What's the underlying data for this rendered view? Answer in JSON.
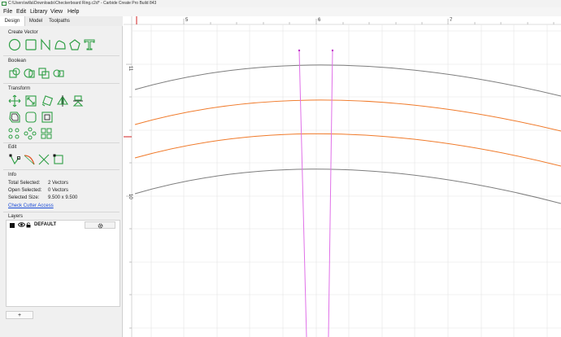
{
  "window": {
    "title": "C:\\Users\\willa\\Downloads\\Checkerboard Ring.c2d* - Carbide Create Pro Build 843"
  },
  "menu": {
    "items": [
      {
        "label": "File",
        "icon": "file-menu"
      },
      {
        "label": "Edit",
        "icon": "edit-menu"
      },
      {
        "label": "Library",
        "icon": "library-menu"
      },
      {
        "label": "View",
        "icon": "view-menu"
      },
      {
        "label": "Help",
        "icon": "help-menu"
      }
    ]
  },
  "tabs": [
    {
      "label": "Design",
      "active": true
    },
    {
      "label": "Model",
      "active": false
    },
    {
      "label": "Toolpaths",
      "active": false
    }
  ],
  "sections": {
    "create_vector": "Create Vector",
    "boolean": "Boolean",
    "transform": "Transform",
    "edit": "Edit",
    "info": "Info",
    "layers": "Layers"
  },
  "tool_icons": {
    "create_vector": [
      "circle-icon",
      "rectangle-icon",
      "polyline-icon",
      "curve-icon",
      "polygon-icon",
      "text-icon"
    ],
    "boolean": [
      "union-icon",
      "subtract-icon",
      "intersect-icon",
      "weld-icon"
    ],
    "transform": [
      "move-icon",
      "scale-icon",
      "rotate-icon",
      "mirror-icon",
      "align-icon",
      "offset-icon",
      "fillet-icon",
      "inset-icon",
      "circular-array-icon",
      "rotational-array-icon",
      "grid-array-icon"
    ],
    "edit": [
      "node-edit-icon",
      "smooth-icon",
      "trim-icon",
      "join-icon"
    ]
  },
  "info": {
    "total_selected_label": "Total Selected:",
    "total_selected_value": "2 Vectors",
    "open_selected_label": "Open Selected:",
    "open_selected_value": "0 Vectors",
    "selected_size_label": "Selected Size:",
    "selected_size_value": "9.500 x 9.500",
    "check_cutter_access": "Check Cutter Access"
  },
  "layers": {
    "items": [
      {
        "name": "DEFAULT",
        "color": "#111111",
        "visible": true,
        "locked": false
      }
    ],
    "settings_icon": "gear-icon",
    "add_label": "+"
  },
  "rulers": {
    "top_labels": [
      "5",
      "6",
      "7"
    ],
    "left_labels": [
      "11",
      "10"
    ]
  },
  "colors": {
    "accent_green": "#2e9e44",
    "arc_gray": "#7d7d7d",
    "arc_orange": "#f07a2a",
    "selected_magenta": "#e070e8",
    "grid": "#e4e4e4",
    "ruler_marker": "#d02020"
  }
}
